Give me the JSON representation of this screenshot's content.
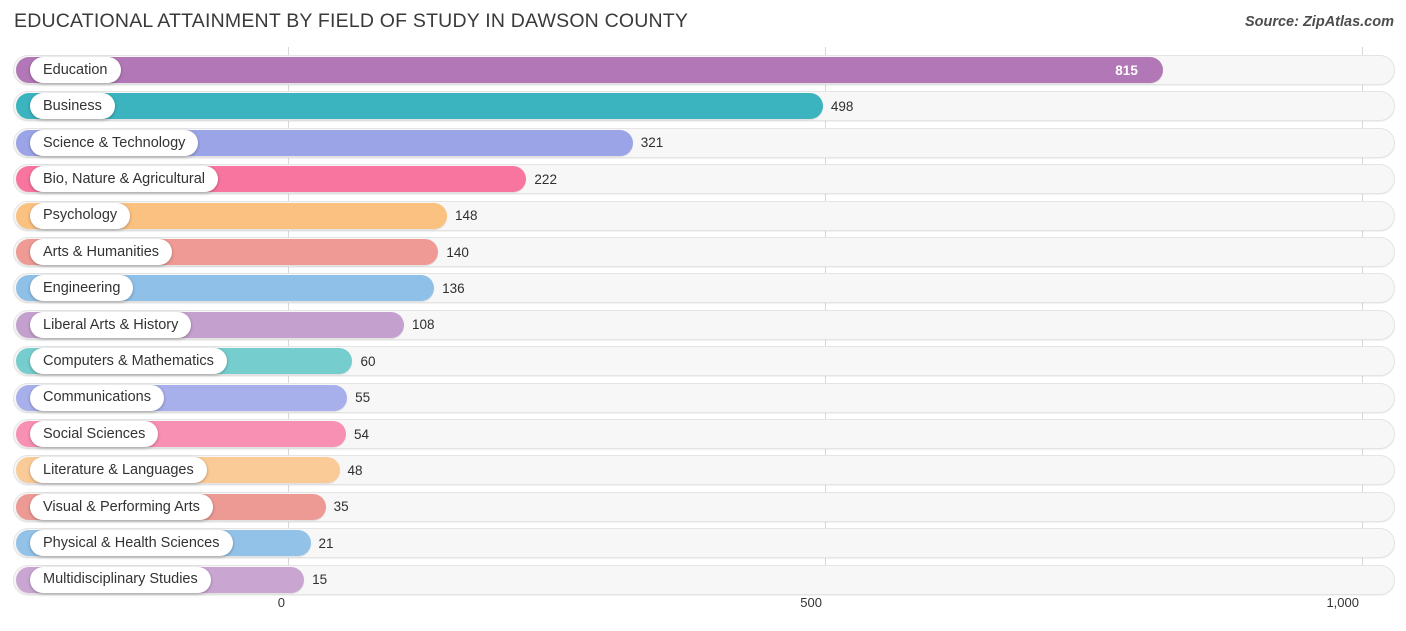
{
  "header": {
    "title": "EDUCATIONAL ATTAINMENT BY FIELD OF STUDY IN DAWSON COUNTY",
    "source": "Source: ZipAtlas.com"
  },
  "chart_data": {
    "type": "bar",
    "orientation": "horizontal",
    "title": "EDUCATIONAL ATTAINMENT BY FIELD OF STUDY IN DAWSON COUNTY",
    "xlabel": "",
    "ylabel": "",
    "xlim": [
      0,
      1000
    ],
    "xticks": [
      "0",
      "500",
      "1,000"
    ],
    "xtick_values": [
      0,
      500,
      1000
    ],
    "grid": true,
    "legend": false,
    "categories": [
      "Education",
      "Business",
      "Science & Technology",
      "Bio, Nature & Agricultural",
      "Psychology",
      "Arts & Humanities",
      "Engineering",
      "Liberal Arts & History",
      "Computers & Mathematics",
      "Communications",
      "Social Sciences",
      "Literature & Languages",
      "Visual & Performing Arts",
      "Physical & Health Sciences",
      "Multidisciplinary Studies"
    ],
    "values": [
      815,
      498,
      321,
      222,
      148,
      140,
      136,
      108,
      60,
      55,
      54,
      48,
      35,
      21,
      15
    ],
    "value_labels": [
      "815",
      "498",
      "321",
      "222",
      "148",
      "140",
      "136",
      "108",
      "60",
      "55",
      "54",
      "48",
      "35",
      "21",
      "15"
    ],
    "colors": [
      "#b277b7",
      "#3bb4bf",
      "#9ba4e6",
      "#f8759f",
      "#fbc181",
      "#ef9a95",
      "#8fc0e8",
      "#c4a0ce",
      "#76cdcd",
      "#a8b0ec",
      "#f890b4",
      "#fbcb97",
      "#ed9a95",
      "#93c2e8",
      "#c9a6d2"
    ]
  },
  "axis": {
    "ticks": [
      "0",
      "500",
      "1,000"
    ]
  }
}
